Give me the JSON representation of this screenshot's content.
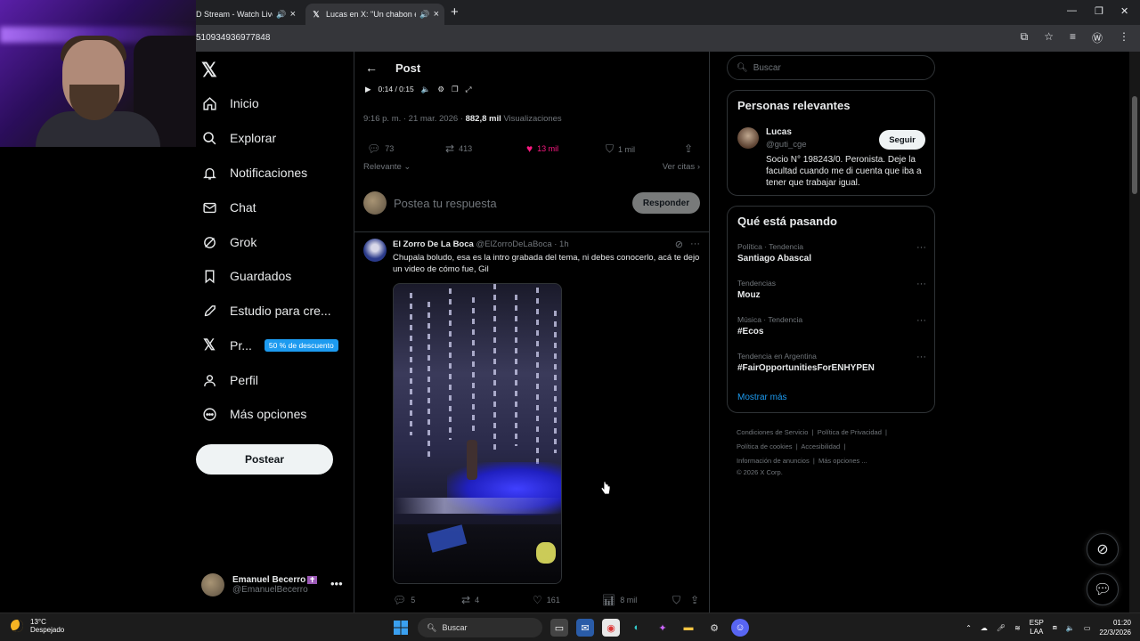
{
  "browser": {
    "tabs": [
      {
        "label": "D Stream - Watch Live o",
        "active": false
      },
      {
        "label": "Lucas en X: \"Un chabon est",
        "active": true
      }
    ],
    "url": "510934936977848"
  },
  "nav": {
    "items": [
      {
        "label": "Inicio",
        "icon": "home-icon"
      },
      {
        "label": "Explorar",
        "icon": "search-icon"
      },
      {
        "label": "Notificaciones",
        "icon": "bell-icon"
      },
      {
        "label": "Chat",
        "icon": "mail-icon"
      },
      {
        "label": "Grok",
        "icon": "grok-icon"
      },
      {
        "label": "Guardados",
        "icon": "bookmark-icon"
      },
      {
        "label": "Estudio para cre...",
        "icon": "rocket-icon"
      },
      {
        "label": "Pr...",
        "icon": "x-premium-icon"
      },
      {
        "label": "Perfil",
        "icon": "person-icon"
      },
      {
        "label": "Más opciones",
        "icon": "more-circle-icon"
      }
    ],
    "promo_badge": "50 % de descuento",
    "post_button": "Postear",
    "account": {
      "name": "Emanuel Becerro",
      "handle": "@EmanuelBecerro",
      "badge": "✝"
    }
  },
  "post": {
    "header_title": "Post",
    "player": {
      "time": "0:14 / 0:15"
    },
    "time_date": "9:16 p. m. · 21 mar. 2026 ·",
    "views_count": "882,8 mil",
    "views_label": "Visualizaciones",
    "replies": "73",
    "reposts": "413",
    "likes": "13 mil",
    "bookmarks": "1 mil",
    "sort_label": "Relevante",
    "quotes_label": "Ver citas",
    "reply_placeholder": "Postea tu respuesta",
    "reply_button": "Responder"
  },
  "reply_tweet": {
    "name": "El Zorro De La Boca",
    "handle": "@ElZorroDeLaBoca",
    "time": "· 1h",
    "text": "Chupala boludo, esa es la intro grabada del tema, ni debes conocerlo, acá te dejo un video de cómo fue, Gil",
    "replies": "5",
    "reposts": "4",
    "likes": "161",
    "views": "8 mil"
  },
  "sidebar": {
    "search_placeholder": "Buscar",
    "relevant": {
      "title": "Personas relevantes",
      "name": "Lucas",
      "handle": "@guti_cge",
      "follow_label": "Seguir",
      "bio": "Socio N° 198243/0. Peronista. Deje la facultad cuando me di cuenta que iba a tener que trabajar igual."
    },
    "trends_title": "Qué está pasando",
    "trends": [
      {
        "category": "Política · Tendencia",
        "name": "Santiago Abascal"
      },
      {
        "category": "Tendencias",
        "name": "Mouz"
      },
      {
        "category": "Música · Tendencia",
        "name": "#Ecos"
      },
      {
        "category": "Tendencia en Argentina",
        "name": "#FairOpportunitiesForENHYPEN"
      }
    ],
    "show_more": "Mostrar más",
    "footer": {
      "terms": "Condiciones de Servicio",
      "privacy": "Política de Privacidad",
      "cookies": "Política de cookies",
      "accessibility": "Accesibilidad",
      "ads": "Información de anuncios",
      "more": "Más opciones ...",
      "copyright": "© 2026 X Corp."
    }
  },
  "taskbar": {
    "temp": "13°C",
    "weather": "Despejado",
    "search": "Buscar",
    "lang_top": "ESP",
    "lang_bottom": "LAA",
    "time": "01:20",
    "date": "22/3/2026"
  },
  "colors": {
    "accent": "#1d9bf0",
    "like": "#f91880",
    "muted": "#71767b"
  }
}
